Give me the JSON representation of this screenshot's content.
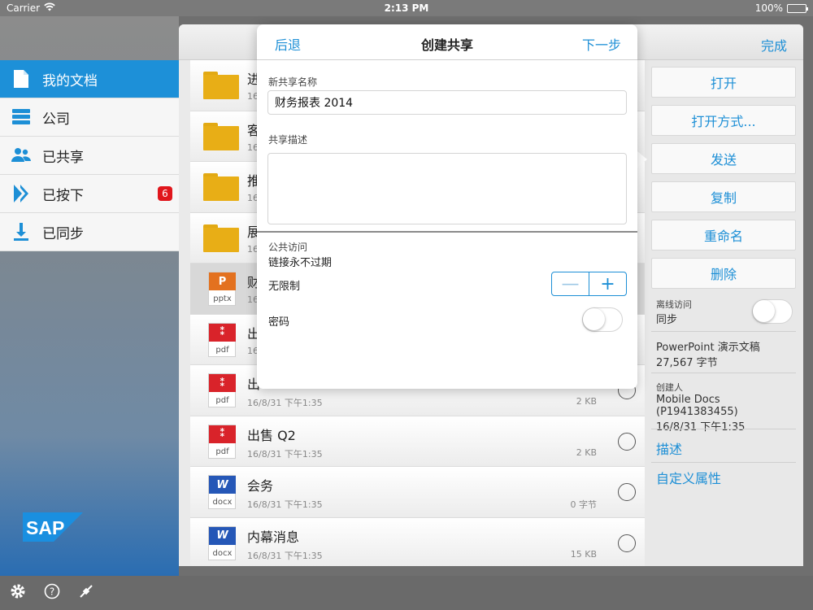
{
  "status_bar": {
    "carrier": "Carrier",
    "time": "2:13 PM",
    "battery": "100%"
  },
  "sidebar": {
    "items": [
      {
        "label": "我的文档",
        "icon": "document-icon",
        "active": true
      },
      {
        "label": "公司",
        "icon": "server-icon"
      },
      {
        "label": "已共享",
        "icon": "people-icon"
      },
      {
        "label": "已按下",
        "icon": "push-icon",
        "badge": "6"
      },
      {
        "label": "已同步",
        "icon": "download-icon"
      }
    ],
    "logo": "SAP"
  },
  "header": {
    "done": "完成"
  },
  "files": [
    {
      "name": "进",
      "meta": "16",
      "type": "folder"
    },
    {
      "name": "客",
      "meta": "16",
      "type": "folder"
    },
    {
      "name": "推",
      "meta": "16",
      "type": "folder"
    },
    {
      "name": "展",
      "meta": "16",
      "type": "folder"
    },
    {
      "name": "财",
      "meta": "16",
      "type": "pptx",
      "ext": "pptx",
      "selected": true
    },
    {
      "name": "出",
      "meta": "16",
      "type": "pdf",
      "ext": "pdf"
    },
    {
      "name": "出",
      "meta": "16/8/31 下午1:35",
      "size": "2 KB",
      "type": "pdf",
      "ext": "pdf"
    },
    {
      "name": "出售 Q2",
      "meta": "16/8/31 下午1:35",
      "size": "2 KB",
      "type": "pdf",
      "ext": "pdf"
    },
    {
      "name": "会务",
      "meta": "16/8/31 下午1:35",
      "size": "0 字节",
      "type": "docx",
      "ext": "docx"
    },
    {
      "name": "内幕消息",
      "meta": "16/8/31 下午1:35",
      "size": "15 KB",
      "type": "docx",
      "ext": "docx"
    }
  ],
  "actions": {
    "open": "打开",
    "open_with": "打开方式...",
    "send": "发送",
    "copy": "复制",
    "rename": "重命名",
    "delete": "删除"
  },
  "details": {
    "offline_label": "离线访问",
    "offline_value": "同步",
    "file_type": "PowerPoint 演示文稿",
    "file_size": "27,567 字节",
    "creator_label": "创建人",
    "creator_name": "Mobile Docs (P1941383455)",
    "created_time": "16/8/31 下午1:35",
    "description_link": "描述",
    "custom_props_link": "自定义属性"
  },
  "popover": {
    "back": "后退",
    "title": "创建共享",
    "next": "下一步",
    "name_label": "新共享名称",
    "name_value": "财务报表 2014",
    "desc_label": "共享描述",
    "desc_value": "",
    "public_access_label": "公共访问",
    "link_never_expires": "链接永不过期",
    "unlimited": "无限制",
    "minus": "—",
    "plus": "+",
    "password": "密码"
  },
  "colors": {
    "accent": "#1d8fd6",
    "sidebar_active": "#1d90d8",
    "badge": "#e0161c",
    "folder": "#e8ae16",
    "pdf": "#d9232a",
    "pptx": "#e3711f",
    "docx": "#2557b7"
  }
}
